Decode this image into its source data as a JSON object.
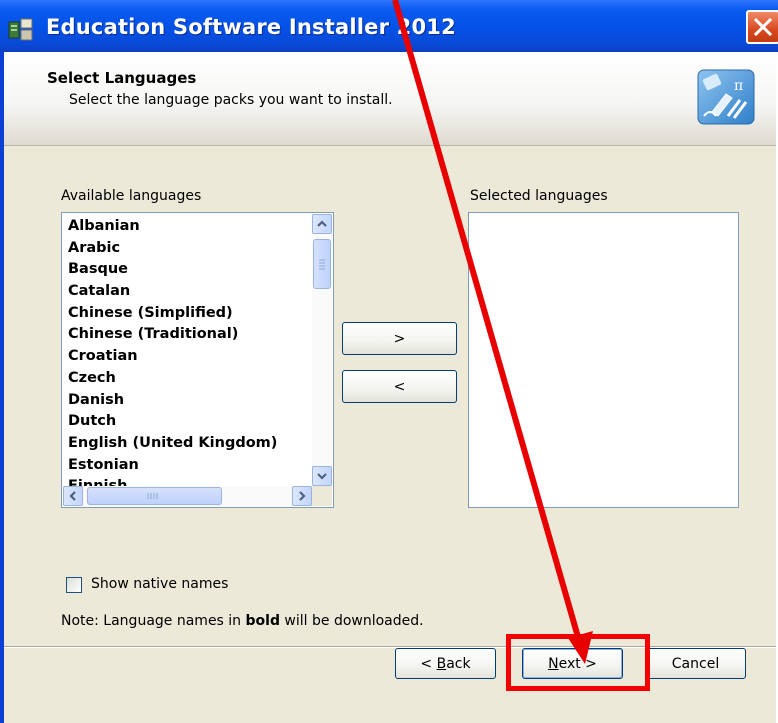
{
  "window": {
    "title": "Education Software Installer 2012"
  },
  "header": {
    "title": "Select Languages",
    "subtitle": "Select the language packs you want to install."
  },
  "available": {
    "label": "Available languages",
    "items": [
      "Albanian",
      "Arabic",
      "Basque",
      "Catalan",
      "Chinese (Simplified)",
      "Chinese (Traditional)",
      "Croatian",
      "Czech",
      "Danish",
      "Dutch",
      "English (United Kingdom)",
      "Estonian",
      "Finnish"
    ]
  },
  "selected": {
    "label": "Selected languages",
    "items": []
  },
  "controls": {
    "add_label": ">",
    "remove_label": "<",
    "show_native_label": "Show native names",
    "show_native_checked": false
  },
  "note": {
    "prefix": "Note: Language names in ",
    "bold": "bold",
    "suffix": " will be downloaded."
  },
  "footer": {
    "back_label": "< Back",
    "back_mnemonic": "B",
    "next_label": "Next >",
    "next_mnemonic": "N",
    "cancel_label": "Cancel"
  },
  "annotation": {
    "color": "#f20000",
    "target": "next-button"
  },
  "colors": {
    "titlebar": "#0a5bf0",
    "dialog_bg": "#ece9d8",
    "close_button": "#d8491f"
  }
}
